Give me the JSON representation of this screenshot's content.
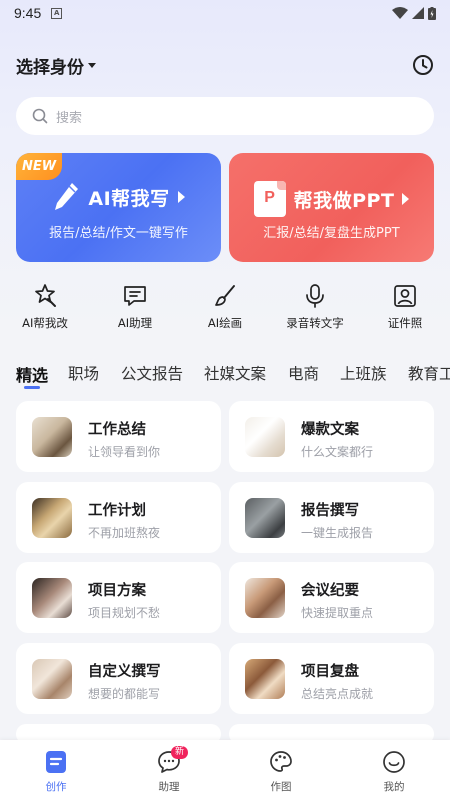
{
  "status_bar": {
    "time": "9:45",
    "notification": "A"
  },
  "header": {
    "identity_label": "选择身份"
  },
  "search": {
    "placeholder": "搜索"
  },
  "cards": [
    {
      "title": "AI帮我写",
      "subtitle": "报告/总结/作文一键写作",
      "badge": "NEW"
    },
    {
      "title": "帮我做PPT",
      "subtitle": "汇报/总结/复盘生成PPT",
      "icon_text": "P"
    }
  ],
  "tools": [
    {
      "label": "AI帮我改",
      "icon": "magic-wand-icon"
    },
    {
      "label": "AI助理",
      "icon": "chat-bubble-icon"
    },
    {
      "label": "AI绘画",
      "icon": "paintbrush-icon"
    },
    {
      "label": "录音转文字",
      "icon": "microphone-icon"
    },
    {
      "label": "证件照",
      "icon": "id-photo-icon"
    }
  ],
  "tabs": [
    "精选",
    "职场",
    "公文报告",
    "社媒文案",
    "电商",
    "上班族",
    "教育工"
  ],
  "items": [
    {
      "name": "工作总结",
      "desc": "让领导看到你"
    },
    {
      "name": "爆款文案",
      "desc": "什么文案都行"
    },
    {
      "name": "工作计划",
      "desc": "不再加班熬夜"
    },
    {
      "name": "报告撰写",
      "desc": "一键生成报告"
    },
    {
      "name": "项目方案",
      "desc": "项目规划不愁"
    },
    {
      "name": "会议纪要",
      "desc": "快速提取重点"
    },
    {
      "name": "自定义撰写",
      "desc": "想要的都能写"
    },
    {
      "name": "项目复盘",
      "desc": "总结亮点成就"
    }
  ],
  "bottom_nav": [
    {
      "label": "创作",
      "icon": "document-icon"
    },
    {
      "label": "助理",
      "icon": "chat-icon",
      "badge": "新"
    },
    {
      "label": "作图",
      "icon": "palette-icon"
    },
    {
      "label": "我的",
      "icon": "smiley-icon"
    }
  ],
  "colors": {
    "accent": "#4b71f3",
    "ppt": "#f1605c",
    "badge": "#ff9a2a",
    "new_dot": "#f0245d"
  }
}
